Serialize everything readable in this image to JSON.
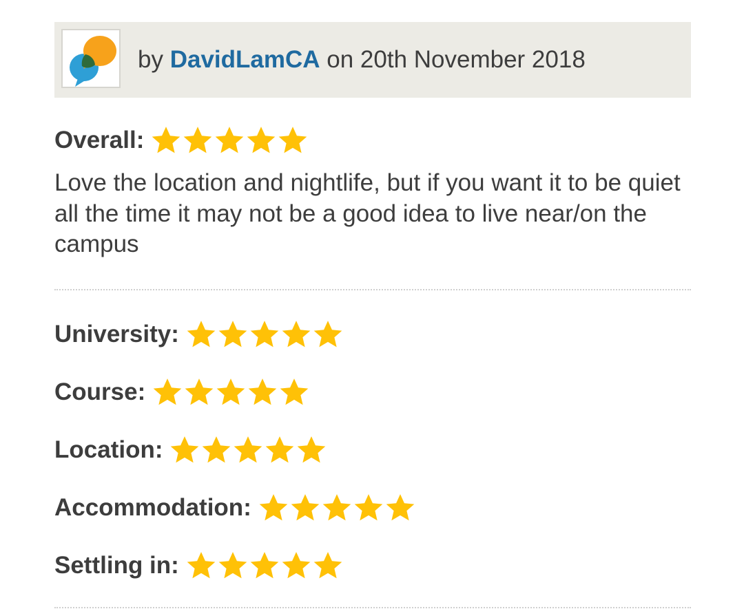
{
  "review": {
    "by_prefix": "by",
    "author": "DavidLamCA",
    "date_text": "on 20th November 2018",
    "overall_label": "Overall:",
    "overall_stars": 5,
    "comment": "Love the location and nightlife, but if you want it to be quiet all the time it may not be a good idea to live near/on the campus",
    "ratings": [
      {
        "label": "University:",
        "stars": 5
      },
      {
        "label": "Course:",
        "stars": 5
      },
      {
        "label": "Location:",
        "stars": 5
      },
      {
        "label": "Accommodation:",
        "stars": 5
      },
      {
        "label": "Settling in:",
        "stars": 5
      }
    ]
  },
  "icons": {
    "avatar": "speech-bubbles-icon",
    "star": "star-icon"
  },
  "colors": {
    "header_bg": "#ecebe5",
    "author_link": "#1f6aa0",
    "star": "#ffc107",
    "bubble_orange": "#f7a21b",
    "bubble_blue": "#2e9fd6",
    "bubble_overlap": "#2f6b3a"
  }
}
